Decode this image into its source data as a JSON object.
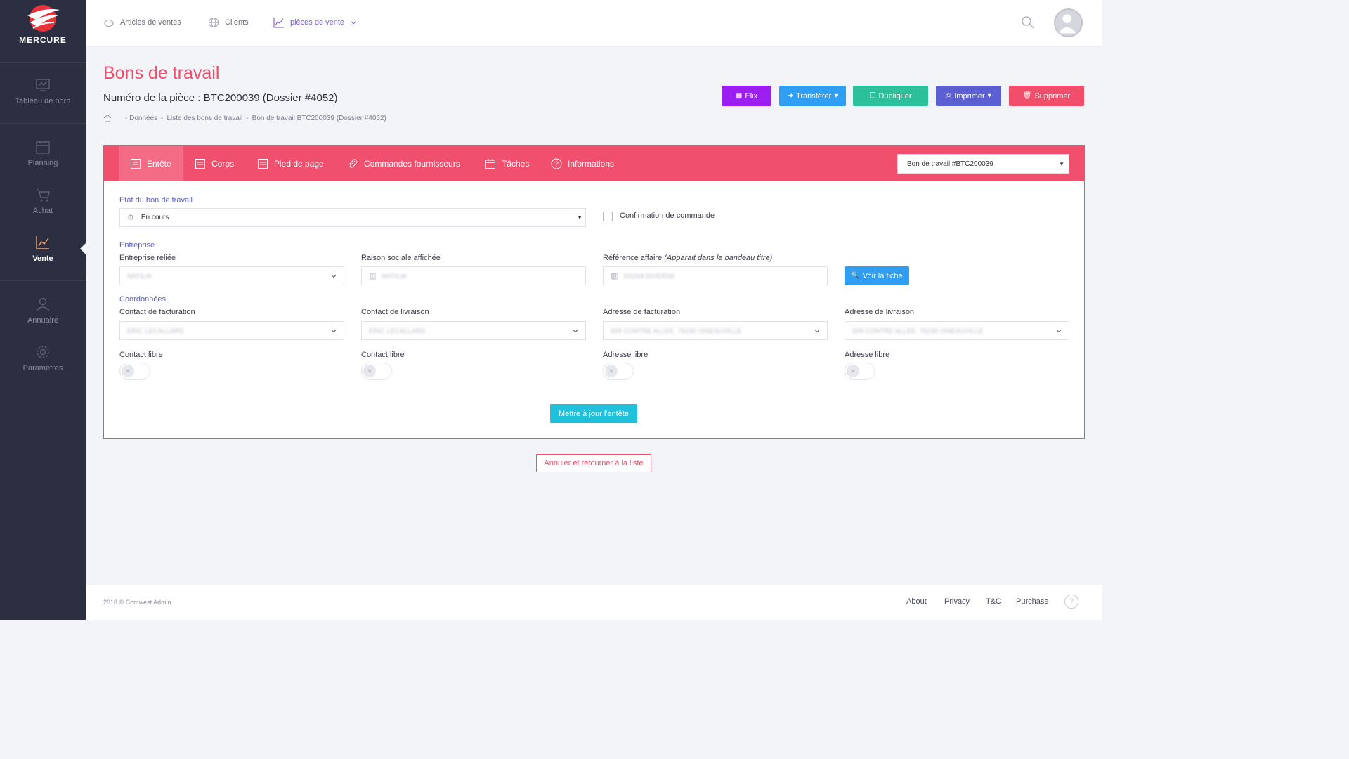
{
  "brand": {
    "name": "MERCURE"
  },
  "sidebar": {
    "items": [
      {
        "label": "Tableau de bord",
        "icon": "dashboard-icon"
      },
      {
        "label": "Planning",
        "icon": "calendar-icon"
      },
      {
        "label": "Achat",
        "icon": "cart-icon"
      },
      {
        "label": "Vente",
        "icon": "chart-icon",
        "active": true
      },
      {
        "label": "Annuaire",
        "icon": "user-icon"
      },
      {
        "label": "Paramètres",
        "icon": "gear-icon"
      }
    ]
  },
  "topbar": {
    "links": [
      {
        "label": "Articles de ventes",
        "icon": "piggy-icon"
      },
      {
        "label": "Clients",
        "icon": "globe-icon"
      },
      {
        "label": "pièces de vente",
        "icon": "chart-icon",
        "active": true
      }
    ]
  },
  "header": {
    "title": "Bons de travail",
    "piece": "Numéro de la pièce : BTC200039 (Dossier #4052)",
    "breadcrumb": [
      "- Données",
      "-",
      "Liste des bons de travail",
      "-",
      "Bon de travail BTC200039 (Dossier #4052)"
    ]
  },
  "actions": {
    "elix": "Elix",
    "transferer": "Transférer",
    "dupliquer": "Dupliquer",
    "imprimer": "Imprimer",
    "supprimer": "Supprimer"
  },
  "colors": {
    "accent": "#f04e6b",
    "purple": "#9c1ef0",
    "blue": "#2f9ef3",
    "teal": "#2bbf9a",
    "indigo": "#5b5fd1",
    "cyan": "#1fc1dc"
  },
  "tabs": [
    {
      "label": "Entête",
      "active": true
    },
    {
      "label": "Corps"
    },
    {
      "label": "Pied de page"
    },
    {
      "label": "Commandes fournisseurs"
    },
    {
      "label": "Tâches"
    },
    {
      "label": "Informations"
    }
  ],
  "doc_select": {
    "value": "Bon de travail #BTC200039"
  },
  "form": {
    "etat_label": "Etat du bon de travail",
    "etat_value": "En cours",
    "confirmation_label": "Confirmation de commande",
    "section_entreprise": "Entreprise",
    "entreprise_label": "Entreprise reliée",
    "entreprise_value": "NATILIA",
    "raison_label": "Raison sociale affichée",
    "raison_value": "NATILIA",
    "reference_label": "Référence affaire",
    "reference_hint": "(Apparait dans le bandeau titre)",
    "reference_value": "SIGNA DIVERSE",
    "voir_fiche": "Voir la fiche",
    "section_coordonnees": "Coordonnées",
    "contact_fact_label": "Contact de facturation",
    "contact_fact_value": "ERIC LECALLARD",
    "contact_liv_label": "Contact de livraison",
    "contact_liv_value": "ERIC LECALLARD",
    "adresse_fact_label": "Adresse de facturation",
    "adresse_fact_value": "509 CONTRE ALLEE, 76230 ISNEAUVILLE",
    "adresse_liv_label": "Adresse de livraison",
    "adresse_liv_value": "509 CONTRE ALLEE, 76230 ISNEAUVILLE",
    "contact_libre": "Contact libre",
    "adresse_libre": "Adresse libre",
    "update_button": "Mettre à jour l'entête"
  },
  "cancel_button": "Annuler et retourner à la liste",
  "footer": {
    "copyright": "2018 © Comwest Admin",
    "links": [
      "About",
      "Privacy",
      "T&C",
      "Purchase"
    ]
  }
}
